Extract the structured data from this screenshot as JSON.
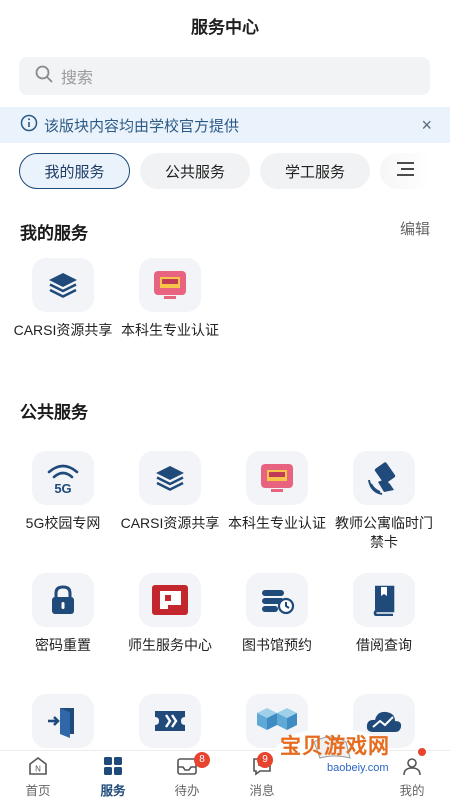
{
  "header": {
    "title": "服务中心"
  },
  "search": {
    "placeholder": "搜索"
  },
  "notice": {
    "text": "该版块内容均由学校官方提供",
    "close": "×"
  },
  "tabs": [
    {
      "label": "我的服务",
      "active": true
    },
    {
      "label": "公共服务",
      "active": false
    },
    {
      "label": "学工服务",
      "active": false
    }
  ],
  "my_services": {
    "title": "我的服务",
    "edit_label": "编辑",
    "items": [
      {
        "label": "CARSI资源共享",
        "icon": "stack-layers-icon"
      },
      {
        "label": "本科生专业认证",
        "icon": "monitor-certificate-icon"
      }
    ]
  },
  "public_services": {
    "title": "公共服务",
    "items": [
      {
        "label": "5G校园专网",
        "icon": "5g-wifi-icon"
      },
      {
        "label": "CARSI资源共享",
        "icon": "stack-layers-icon"
      },
      {
        "label": "本科生专业认证",
        "icon": "monitor-certificate-icon"
      },
      {
        "label": "教师公寓临时门禁卡",
        "icon": "access-card-icon"
      },
      {
        "label": "密码重置",
        "icon": "lock-icon"
      },
      {
        "label": "师生服务中心",
        "icon": "service-center-icon"
      },
      {
        "label": "图书馆预约",
        "icon": "library-booking-icon"
      },
      {
        "label": "借阅查询",
        "icon": "book-icon"
      },
      {
        "label": "",
        "icon": "exit-door-icon"
      },
      {
        "label": "",
        "icon": "ticket-icon"
      },
      {
        "label": "",
        "icon": "cubes-icon"
      },
      {
        "label": "",
        "icon": "cloud-chart-icon"
      }
    ]
  },
  "tabbar": {
    "items": [
      {
        "label": "首页",
        "icon": "home-icon",
        "active": false
      },
      {
        "label": "服务",
        "icon": "grid-icon",
        "active": true
      },
      {
        "label": "待办",
        "icon": "inbox-icon",
        "active": false,
        "badge": "8"
      },
      {
        "label": "消息",
        "icon": "chat-icon",
        "active": false,
        "badge": "9"
      },
      {
        "label": "我的",
        "icon": "user-icon",
        "active": false
      }
    ]
  },
  "watermark": {
    "text": "宝贝游戏网",
    "url": "baobeiy.com"
  },
  "colors": {
    "brand_navy": "#1f4a7a",
    "notice_bg": "#eaf2fb",
    "badge_red": "#e8432f",
    "icon_pink": "#e8637f"
  }
}
